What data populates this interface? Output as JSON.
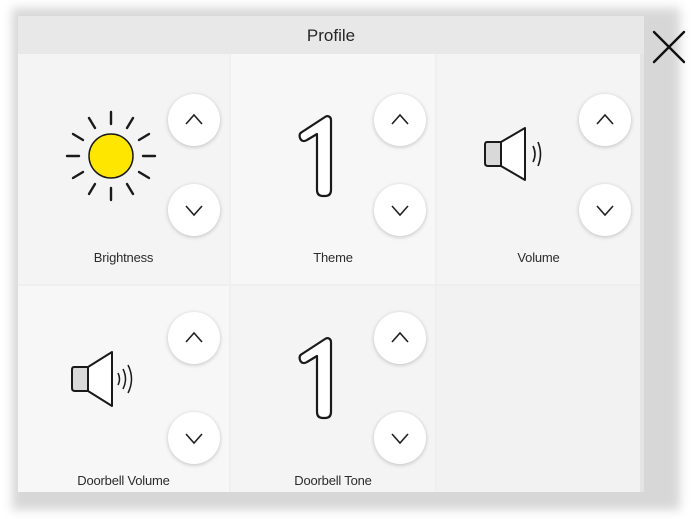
{
  "window": {
    "title": "Profile"
  },
  "settings": [
    {
      "label": "Brightness",
      "icon": "sun-icon",
      "icon_color": "#FFE600"
    },
    {
      "label": "Theme",
      "value": "1"
    },
    {
      "label": "Volume",
      "icon": "speaker-icon"
    },
    {
      "label": "Doorbell Volume",
      "icon": "speaker-icon"
    },
    {
      "label": "Doorbell Tone",
      "value": "1"
    }
  ],
  "icons": {
    "close": "close-icon",
    "up": "chevron-up-icon",
    "down": "chevron-down-icon"
  }
}
